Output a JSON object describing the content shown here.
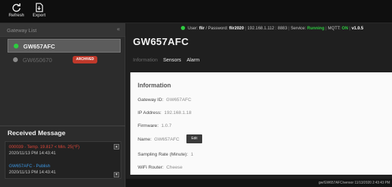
{
  "toolbar": {
    "refresh_label": "Refresh",
    "export_label": "Export",
    "refresh_icon": "refresh-icon",
    "export_icon": "export-icon"
  },
  "sidebar": {
    "gateway_list_title": "Gateway List",
    "collapse_glyph": "«",
    "gateways": [
      {
        "name": "GW657AFC",
        "status_color": "#2ecc40",
        "selected": true
      },
      {
        "name": "GW650670",
        "status_color": "#8a8a8a",
        "badge": "ARCHIVED",
        "badge_color": "#c0392b"
      }
    ],
    "received_title": "Received Message",
    "messages": [
      {
        "line1": "000039 - Temp. 19.817 < Min. 25(°F)",
        "line2": "2020/11/13 PM 14:43:41",
        "color": "#e0473a"
      },
      {
        "line1": "GW657AFC - Publish",
        "line2": "2020/11/13 PM 14:43:41",
        "color": "#3d9ae8"
      }
    ]
  },
  "status_bar": {
    "dot_color": "#2ecc40",
    "user_label": "User:",
    "user": "flir",
    "password_label": "/ Password:",
    "password": "flir2020",
    "address": "192.168.1.112 : 8883",
    "service_label": "Service:",
    "service_status": "Running",
    "mqtt_label": "MQTT:",
    "mqtt_status": "ON",
    "version": "v1.0.5"
  },
  "main": {
    "title": "GW657AFC",
    "tabs": [
      "Information",
      "Sensors",
      "Alarm"
    ]
  },
  "info": {
    "heading": "Information",
    "gateway_id_label": "Gateway ID:",
    "gateway_id": "GW657AFC",
    "ip_label": "IP Address:",
    "ip": "192.168.1.18",
    "firmware_label": "Firmware:",
    "firmware": "1.0.7",
    "name_label": "Name:",
    "name": "GW657AFC",
    "edit_label": "Edit",
    "sampling_label": "Sampling Rate (Minute):",
    "sampling": "1",
    "wifi_label": "WiFi Router:",
    "wifi": "Cheese"
  },
  "footer": {
    "topic": "gw/GW657AFC/sensor 11/13/2020 2:43:43 PM"
  },
  "colors": {
    "online": "#2ecc40",
    "offline": "#8a8a8a",
    "alert": "#e0473a",
    "publish": "#3d9ae8",
    "archived": "#c0392b"
  }
}
